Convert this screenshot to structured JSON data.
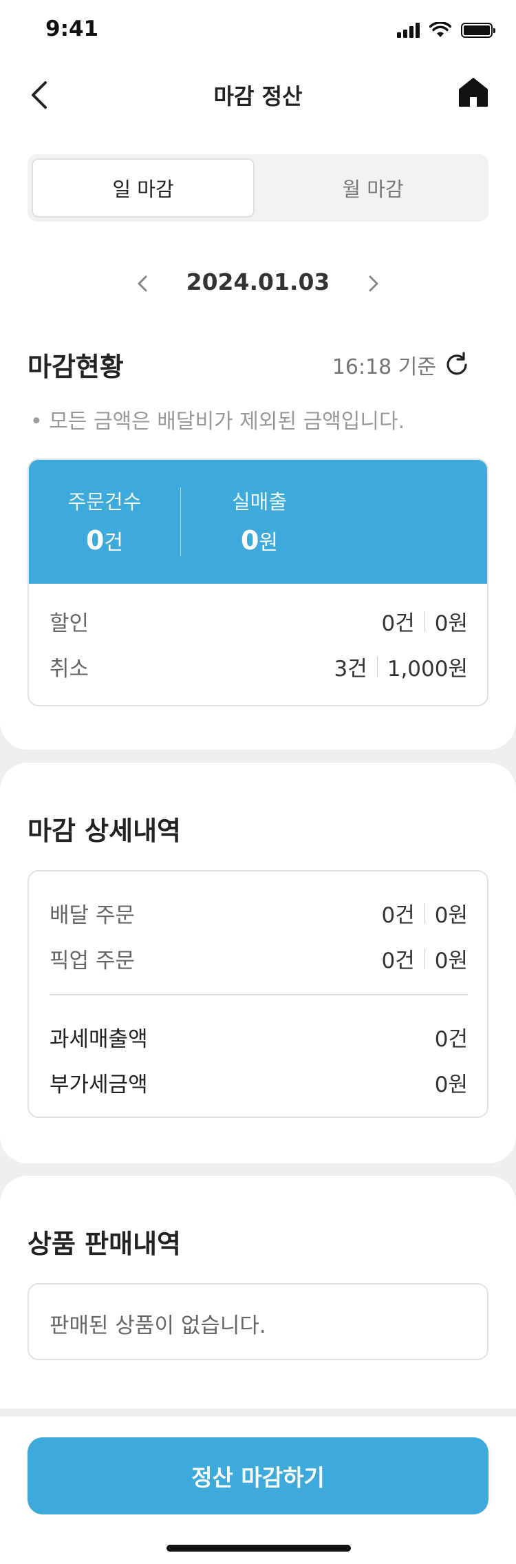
{
  "status": {
    "time": "9:41"
  },
  "header": {
    "title": "마감 정산"
  },
  "tabs": [
    {
      "label": "일 마감",
      "selected": true
    },
    {
      "label": "월 마감",
      "selected": false
    }
  ],
  "date": {
    "value": "2024.01.03"
  },
  "status_section": {
    "title": "마감현황",
    "updated": "16:18 기준",
    "note": "• 모든 금액은 배달비가 제외된 금액입니다.",
    "summary": [
      {
        "label": "주문건수",
        "value": "0",
        "unit": "건"
      },
      {
        "label": "실매출",
        "value": "0",
        "unit": "원"
      }
    ],
    "rows": [
      {
        "label": "할인",
        "count": "0건",
        "amount": "0원"
      },
      {
        "label": "취소",
        "count": "3건",
        "amount": "1,000원"
      }
    ]
  },
  "detail_section": {
    "title": "마감 상세내역",
    "rows": [
      {
        "label": "배달 주문",
        "count": "0건",
        "amount": "0원"
      },
      {
        "label": "픽업 주문",
        "count": "0건",
        "amount": "0원"
      }
    ],
    "totals": [
      {
        "label": "과세매출액",
        "value": "0건"
      },
      {
        "label": "부가세금액",
        "value": "0원"
      }
    ]
  },
  "products_section": {
    "title": "상품 판매내역",
    "empty_text": "판매된 상품이 없습니다."
  },
  "footer": {
    "button_label": "정산 마감하기"
  },
  "colors": {
    "accent": "#3eaadb"
  }
}
